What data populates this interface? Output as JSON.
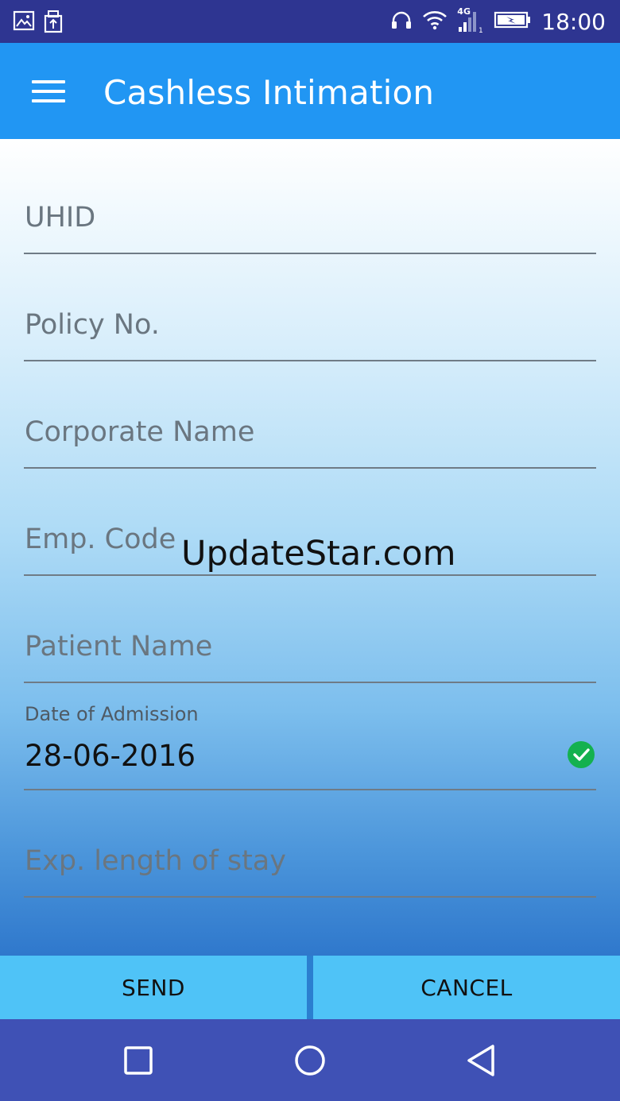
{
  "status_bar": {
    "time": "18:00",
    "network_label": "4G",
    "left_icons": [
      "image-icon",
      "usb-icon"
    ],
    "right_icons": [
      "headphones-icon",
      "wifi-icon",
      "signal-icon",
      "battery-charging-icon"
    ]
  },
  "app_bar": {
    "title": "Cashless Intimation",
    "menu_icon": "hamburger-menu-icon"
  },
  "form": {
    "fields": [
      {
        "id": "uhid",
        "placeholder": "UHID",
        "value": ""
      },
      {
        "id": "policy_no",
        "placeholder": "Policy No.",
        "value": ""
      },
      {
        "id": "corporate_name",
        "placeholder": "Corporate Name",
        "value": ""
      },
      {
        "id": "emp_code",
        "placeholder": "Emp. Code",
        "value": ""
      },
      {
        "id": "patient_name",
        "placeholder": "Patient Name",
        "value": ""
      },
      {
        "id": "date_of_admission",
        "label": "Date of Admission",
        "value": "28-06-2016",
        "valid_icon": "check-circle-icon",
        "valid_color": "#14b14f"
      },
      {
        "id": "exp_length_of_stay",
        "placeholder": "Exp. length of stay",
        "value": ""
      }
    ]
  },
  "watermark": "UpdateStar.com",
  "buttons": {
    "send": "SEND",
    "cancel": "CANCEL"
  },
  "nav_bar": {
    "icons": [
      "recent-apps-icon",
      "home-icon",
      "back-icon"
    ]
  },
  "colors": {
    "status_bar": "#2e3591",
    "app_bar": "#2196f3",
    "button_bar": "#4fc3f7",
    "nav_bar": "#3f51b5"
  }
}
